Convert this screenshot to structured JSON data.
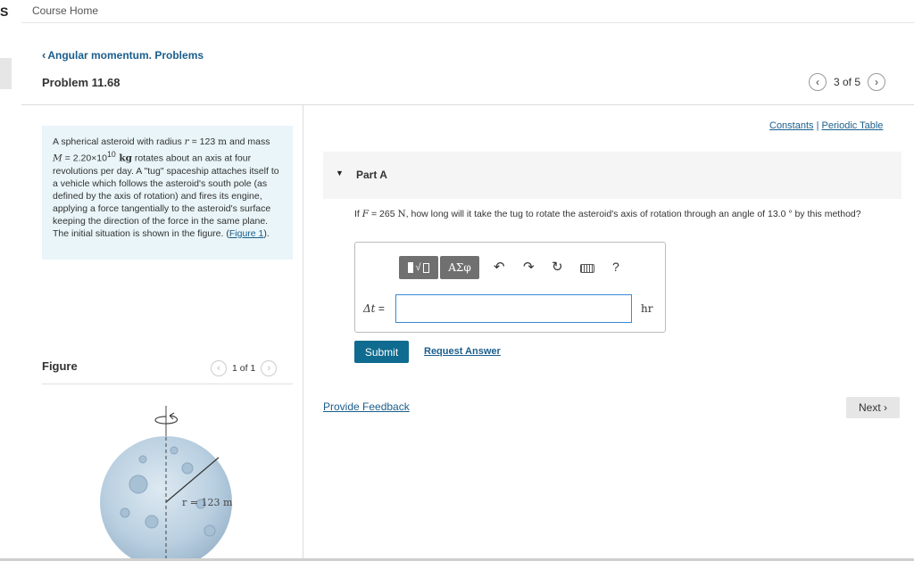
{
  "nav": {
    "left_letter": "S",
    "course_home": "Course Home",
    "back_label": "Angular momentum. Problems",
    "problem_title": "Problem 11.68",
    "pager": "3 of 5"
  },
  "problem": {
    "text_1": "A spherical asteroid with radius ",
    "r_sym": "r",
    "text_2": " = 123 ",
    "r_unit": "m",
    "text_3": " and mass ",
    "M_sym": "M",
    "text_4": " = 2.20×10",
    "M_exp": "10",
    "M_unit": " kg",
    "text_5": " rotates about an axis at four revolutions per day. A \"tug\" spaceship attaches itself to a vehicle which follows the asteroid's south pole (as defined by the axis of rotation) and fires its engine, applying a force tangentially to the asteroid's surface keeping the direction of the force in the same plane. The initial situation is shown in the figure. (",
    "figure_link": "Figure 1",
    "text_6": ")."
  },
  "figure": {
    "label": "Figure",
    "pager": "1 of 1",
    "radius_label": "r = 123 m"
  },
  "links": {
    "constants": "Constants",
    "separator": " | ",
    "periodic_table": "Periodic Table"
  },
  "part_a": {
    "label": "Part A",
    "q_1": "If ",
    "F_sym": "F",
    "q_2": " = 265 ",
    "F_unit": "N",
    "q_3": ", how long will it take the tug to rotate the asteroid's axis of rotation through an angle of 13.0 ° by this method?"
  },
  "answer": {
    "greek_label": "ΑΣφ",
    "help_label": "?",
    "delta_sym": "Δt",
    "eq": " =",
    "unit": "hr",
    "value": ""
  },
  "actions": {
    "submit": "Submit",
    "request_answer": "Request Answer",
    "feedback": "Provide Feedback",
    "next": "Next"
  },
  "icons": {
    "undo": "undo-icon",
    "redo": "redo-icon",
    "reset": "reset-icon",
    "keyboard": "keyboard-icon"
  }
}
